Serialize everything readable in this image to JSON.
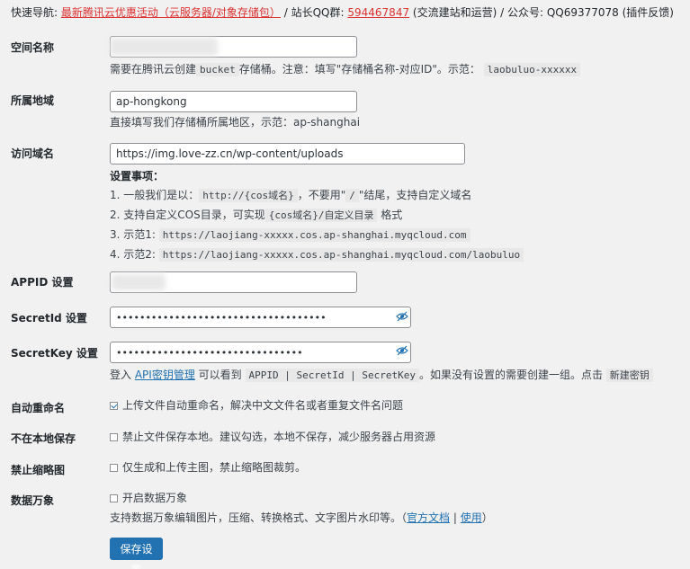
{
  "nav": {
    "prefix": "快速导航:",
    "promo_link": "最新腾讯云优惠活动（云服务器/对象存储包）",
    "sep1": "/ 站长QQ群:",
    "qq_group_link": "594467847",
    "qq_group_note": "(交流建站和运营)",
    "sep2": "/ 公众号: QQ69377078 (插件反馈)"
  },
  "colors": {
    "accent": "#2271b1",
    "danger": "#dc3232",
    "background": "#f1f1f1"
  },
  "fields": {
    "bucket": {
      "label": "空间名称",
      "value": "",
      "desc_pre": "需要在腾讯云创建",
      "desc_code1": "bucket",
      "desc_mid": "存储桶。注意：填写\"存储桶名称-对应ID\"。示范：",
      "desc_code2": "laobuluo-xxxxxx"
    },
    "region": {
      "label": "所属地域",
      "value": "ap-hongkong",
      "desc": "直接填写我们存储桶所属地区，示范：ap-shanghai"
    },
    "domain": {
      "label": "访问域名",
      "value": "https://img.love-zz.cn/wp-content/uploads",
      "tips_title": "设置事项：",
      "tip1_pre": "1. 一般我们是以：",
      "tip1_code": "http://{cos域名}",
      "tip1_mid": "，不要用\"",
      "tip1_code2": "/",
      "tip1_post": "\"结尾，支持自定义域名",
      "tip2_pre": "2. 支持自定义COS目录，可实现",
      "tip2_code": "{cos域名}/自定义目录",
      "tip2_post": "格式",
      "tip3_pre": "3. 示范1:",
      "tip3_code": "https://laojiang-xxxxx.cos.ap-shanghai.myqcloud.com",
      "tip4_pre": "4. 示范2:",
      "tip4_code": "https://laojiang-xxxxx.cos.ap-shanghai.myqcloud.com/laobuluo"
    },
    "appid": {
      "label": "APPID 设置",
      "value": ""
    },
    "secret_id": {
      "label": "SecretId 设置",
      "value": "••••••••••••••••••••••••••••••••••••"
    },
    "secret_key": {
      "label": "SecretKey 设置",
      "value": "••••••••••••••••••••••••••••••••",
      "desc_pre": "登入",
      "desc_link": "API密钥管理",
      "desc_mid": "可以看到",
      "desc_code": "APPID | SecretId | SecretKey",
      "desc_post": "。如果没有设置的需要创建一组。点击",
      "desc_code2": "新建密钥"
    }
  },
  "options": {
    "auto_rename": {
      "label": "自动重命名",
      "checked": true,
      "text": "上传文件自动重命名，解决中文文件名或者重复文件名问题"
    },
    "no_local": {
      "label": "不在本地保存",
      "checked": false,
      "text": "禁止文件保存本地。建议勾选，本地不保存，减少服务器占用资源"
    },
    "no_thumb": {
      "label": "禁止缩略图",
      "checked": false,
      "text": "仅生成和上传主图，禁止缩略图裁剪。"
    },
    "ci": {
      "label": "数据万象",
      "checked": false,
      "text": "开启数据万象",
      "desc_pre": "支持数据万象编辑图片，压缩、转换格式、文字图片水印等。（",
      "desc_link1": "官方文档",
      "desc_sep": "|",
      "desc_link2": "使用",
      "desc_post": "）"
    }
  },
  "save_label": "保存设置"
}
